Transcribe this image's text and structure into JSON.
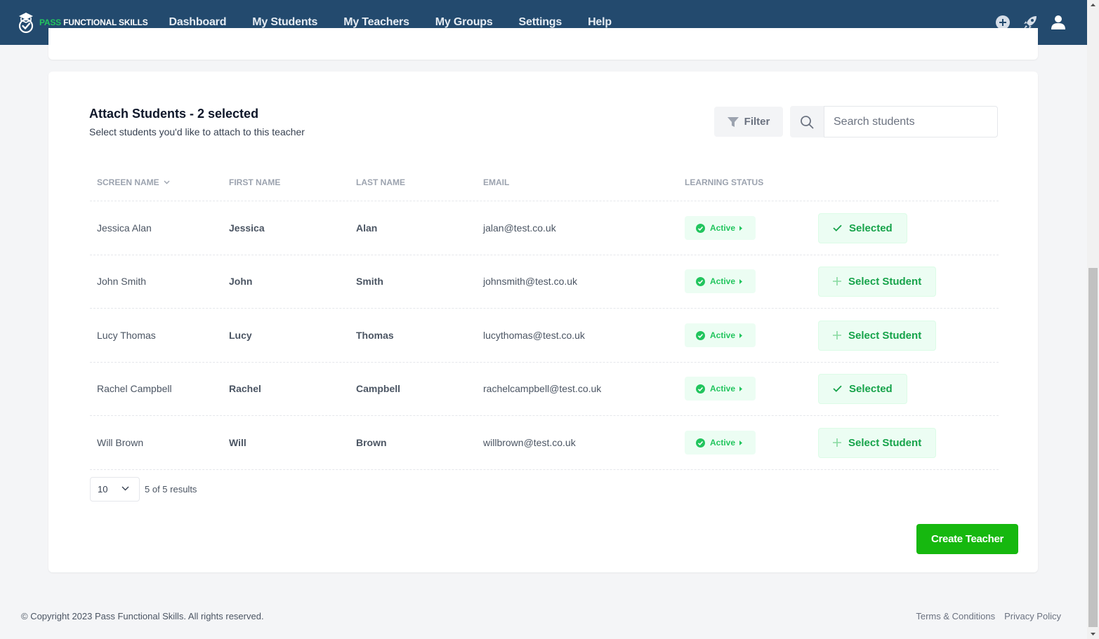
{
  "app": {
    "logo_prefix": "PASS",
    "logo_suffix": "FUNCTIONAL SKILLS",
    "nav": [
      {
        "label": "Dashboard"
      },
      {
        "label": "My Students"
      },
      {
        "label": "My Teachers"
      },
      {
        "label": "My Groups"
      },
      {
        "label": "Settings"
      },
      {
        "label": "Help"
      }
    ],
    "icons": [
      "plus-circle-icon",
      "rocket-icon",
      "user-icon"
    ],
    "colors": {
      "header": "#234a6e",
      "accent": "#22c55e",
      "primary_button": "#16b80f"
    }
  },
  "attach": {
    "title": "Attach Students - 2 selected",
    "subtitle": "Select students you'd like to attach to this teacher",
    "filter_label": "Filter",
    "search_placeholder": "Search students"
  },
  "table": {
    "headers": {
      "screen_name": "SCREEN NAME",
      "first_name": "FIRST NAME",
      "last_name": "LAST NAME",
      "email": "EMAIL",
      "learning_status": "LEARNING STATUS"
    },
    "rows": [
      {
        "screen_name": "Jessica Alan",
        "first_name": "Jessica",
        "last_name": "Alan",
        "email": "jalan@test.co.uk",
        "status": "Active",
        "action": "Selected",
        "selected": true
      },
      {
        "screen_name": "John Smith",
        "first_name": "John",
        "last_name": "Smith",
        "email": "johnsmith@test.co.uk",
        "status": "Active",
        "action": "Select Student",
        "selected": false
      },
      {
        "screen_name": "Lucy Thomas",
        "first_name": "Lucy",
        "last_name": "Thomas",
        "email": "lucythomas@test.co.uk",
        "status": "Active",
        "action": "Select Student",
        "selected": false
      },
      {
        "screen_name": "Rachel Campbell",
        "first_name": "Rachel",
        "last_name": "Campbell",
        "email": "rachelcampbell@test.co.uk",
        "status": "Active",
        "action": "Selected",
        "selected": true
      },
      {
        "screen_name": "Will Brown",
        "first_name": "Will",
        "last_name": "Brown",
        "email": "willbrown@test.co.uk",
        "status": "Active",
        "action": "Select Student",
        "selected": false
      }
    ]
  },
  "pagination": {
    "page_size": "10",
    "results": "5 of 5 results"
  },
  "create_button": "Create Teacher",
  "footer": {
    "copyright": "© Copyright 2023 Pass Functional Skills. All rights reserved.",
    "links": [
      {
        "label": "Terms & Conditions"
      },
      {
        "label": "Privacy Policy"
      }
    ]
  }
}
